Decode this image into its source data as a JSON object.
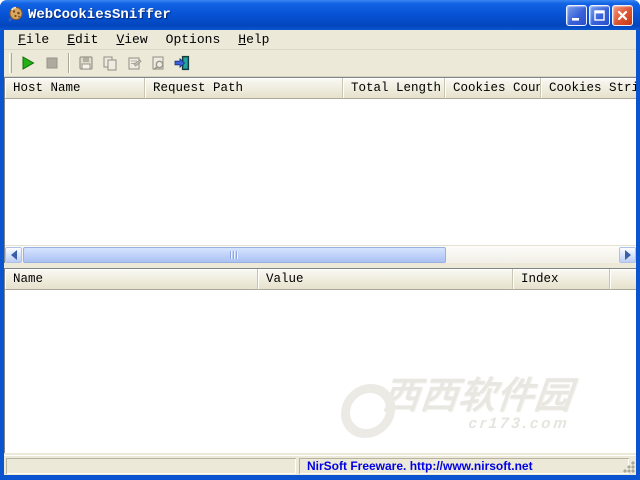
{
  "window": {
    "title": "WebCookiesSniffer"
  },
  "menu_bar": {
    "items": [
      {
        "label": "File"
      },
      {
        "label": "Edit"
      },
      {
        "label": "View"
      },
      {
        "label": "Options"
      },
      {
        "label": "Help"
      }
    ]
  },
  "toolbar": {
    "buttons": [
      {
        "name": "start-capture",
        "icon": "play-icon",
        "enabled": true
      },
      {
        "name": "stop-capture",
        "icon": "stop-icon",
        "enabled": false
      },
      {
        "name": "save",
        "icon": "floppy-disk-icon",
        "enabled": false
      },
      {
        "name": "copy",
        "icon": "copy-icon",
        "enabled": false
      },
      {
        "name": "properties",
        "icon": "properties-icon",
        "enabled": false
      },
      {
        "name": "html-report",
        "icon": "report-magnifier-icon",
        "enabled": false
      },
      {
        "name": "exit",
        "icon": "exit-door-icon",
        "enabled": true
      }
    ]
  },
  "cookies_table": {
    "columns": [
      "Host Name",
      "Request Path",
      "Total Length",
      "Cookies Count",
      "Cookies String"
    ],
    "rows": []
  },
  "cookie_detail_table": {
    "columns": [
      "Name",
      "Value",
      "Index"
    ],
    "rows": []
  },
  "status_bar": {
    "left_text": "",
    "right_text": "NirSoft Freeware.  http://www.nirsoft.net"
  },
  "watermark": {
    "main": "西西软件园",
    "sub": "cr173.com"
  },
  "colors": {
    "titlebar_blue": "#0854d6",
    "window_border_blue": "#0a54d0",
    "client_beige": "#ece9d8",
    "status_link_blue": "#0000e6",
    "play_green": "#22b014",
    "exit_door_teal": "#1a8280"
  }
}
